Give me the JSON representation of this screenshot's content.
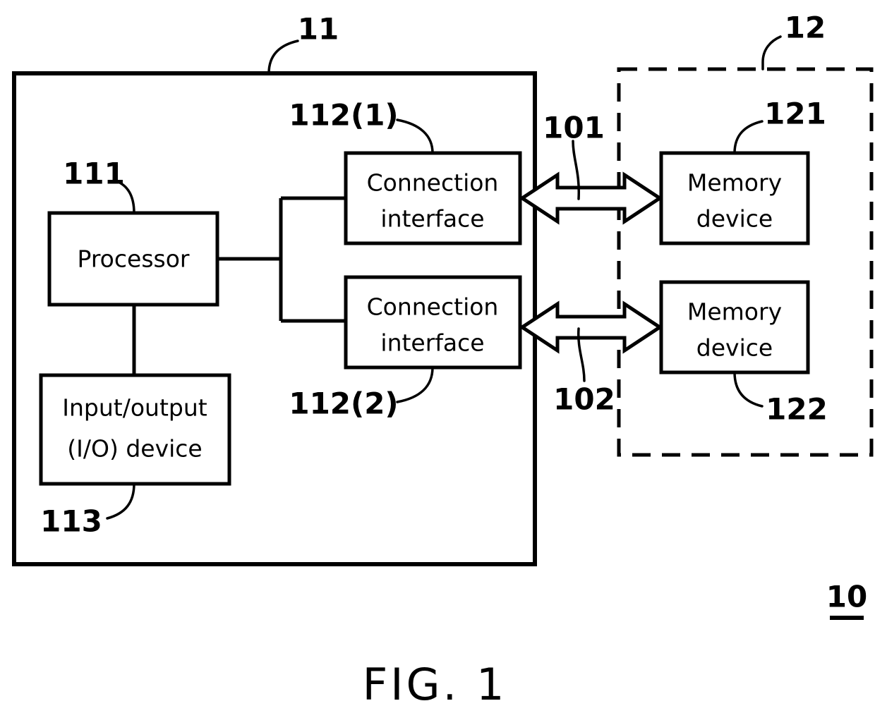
{
  "figure": {
    "caption": "FIG. 1",
    "system_ref": "10"
  },
  "host_system": {
    "ref": "11",
    "blocks": [
      {
        "id": "processor",
        "ref": "111",
        "label_line1": "Processor",
        "label_line2": ""
      },
      {
        "id": "io-device",
        "ref": "113",
        "label_line1": "Input/output",
        "label_line2": "(I/O) device"
      },
      {
        "id": "connection-interface-1",
        "ref": "112(1)",
        "label_line1": "Connection",
        "label_line2": "interface"
      },
      {
        "id": "connection-interface-2",
        "ref": "112(2)",
        "label_line1": "Connection",
        "label_line2": "interface"
      }
    ]
  },
  "storage_group": {
    "ref": "12",
    "blocks": [
      {
        "id": "memory-device-1",
        "ref": "121",
        "label_line1": "Memory",
        "label_line2": "device"
      },
      {
        "id": "memory-device-2",
        "ref": "122",
        "label_line1": "Memory",
        "label_line2": "device"
      }
    ]
  },
  "links": [
    {
      "id": "link-1",
      "ref": "101",
      "from": "connection-interface-1",
      "to": "memory-device-1",
      "kind": "bidirectional"
    },
    {
      "id": "link-2",
      "ref": "102",
      "from": "connection-interface-2",
      "to": "memory-device-2",
      "kind": "bidirectional"
    }
  ],
  "colors": {
    "stroke": "#000000",
    "background": "#ffffff"
  }
}
